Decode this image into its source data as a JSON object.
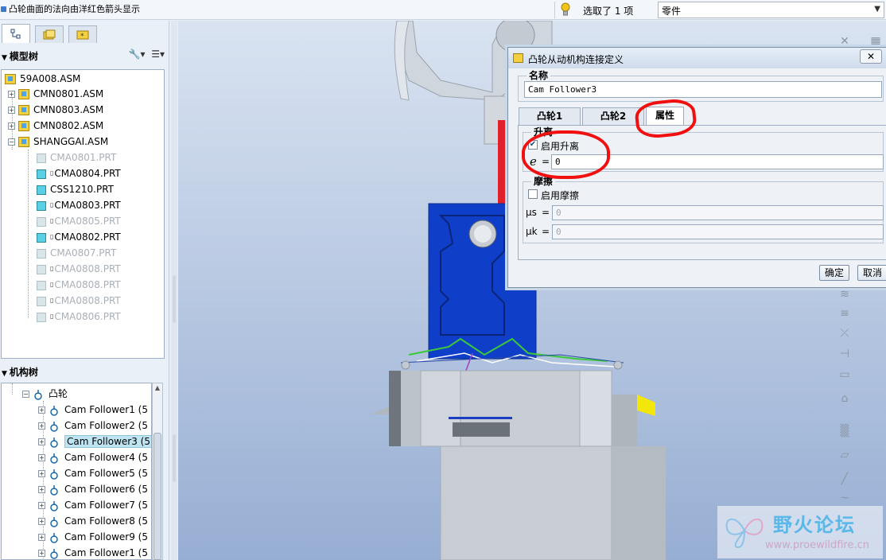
{
  "statusbar": {
    "message": "凸轮曲面的法向由洋红色箭头显示",
    "selection_count": "选取了 1 项",
    "filter_value": "零件"
  },
  "left_panel": {
    "model_tree": {
      "header": "模型树",
      "items": [
        {
          "label": "59A008.ASM",
          "kind": "asm",
          "state": "normal"
        },
        {
          "label": "CMN0801.ASM",
          "kind": "asm",
          "state": "normal"
        },
        {
          "label": "CMN0803.ASM",
          "kind": "asm",
          "state": "normal"
        },
        {
          "label": "CMN0802.ASM",
          "kind": "asm",
          "state": "normal"
        },
        {
          "label": "SHANGGAI.ASM",
          "kind": "asm",
          "state": "normal"
        },
        {
          "label": "CMA0801.PRT",
          "kind": "prt",
          "state": "dim"
        },
        {
          "label": "CMA0804.PRT",
          "kind": "prt",
          "state": "normal"
        },
        {
          "label": "CSS1210.PRT",
          "kind": "prt",
          "state": "normal"
        },
        {
          "label": "CMA0803.PRT",
          "kind": "prt",
          "state": "normal"
        },
        {
          "label": "CMA0805.PRT",
          "kind": "prt",
          "state": "dim"
        },
        {
          "label": "CMA0802.PRT",
          "kind": "prt",
          "state": "normal"
        },
        {
          "label": "CMA0807.PRT",
          "kind": "prt",
          "state": "dim"
        },
        {
          "label": "CMA0808.PRT",
          "kind": "prt",
          "state": "dim"
        },
        {
          "label": "CMA0808.PRT",
          "kind": "prt",
          "state": "dim"
        },
        {
          "label": "CMA0808.PRT",
          "kind": "prt",
          "state": "dim"
        },
        {
          "label": "CMA0806.PRT",
          "kind": "prt",
          "state": "dim"
        }
      ]
    },
    "mech_tree": {
      "header": "机构树",
      "root": "凸轮",
      "items": [
        "Cam Follower1 (5",
        "Cam Follower2 (5",
        "Cam Follower3 (5",
        "Cam Follower4 (5",
        "Cam Follower5 (5",
        "Cam Follower6 (5",
        "Cam Follower7 (5",
        "Cam Follower8 (5",
        "Cam Follower9 (5",
        "Cam Follower1 (5"
      ],
      "selected_index": 2
    }
  },
  "dialog": {
    "title": "凸轮从动机构连接定义",
    "name_group": "名称",
    "name_value": "Cam Follower3",
    "tabs": [
      "凸轮1",
      "凸轮2",
      "属性"
    ],
    "active_tab": 2,
    "liftoff_group": "升离",
    "liftoff_checkbox": "启用升离",
    "liftoff_checked": true,
    "e_label": "e",
    "eq": "=",
    "e_value": "0",
    "friction_group": "摩擦",
    "friction_checkbox": "启用摩擦",
    "friction_checked": false,
    "mu_s_label": "μs",
    "mu_s_value": "0",
    "mu_k_label": "μk",
    "mu_k_value": "0",
    "ok_button": "确定",
    "cancel_button": "取消"
  },
  "watermark": {
    "title": "野火论坛",
    "url": "www.proewildfire.cn"
  },
  "colors": {
    "annotation_red": "#f01010",
    "part_blue": "#0f3fc8",
    "highlight": "#bfe4f2"
  }
}
